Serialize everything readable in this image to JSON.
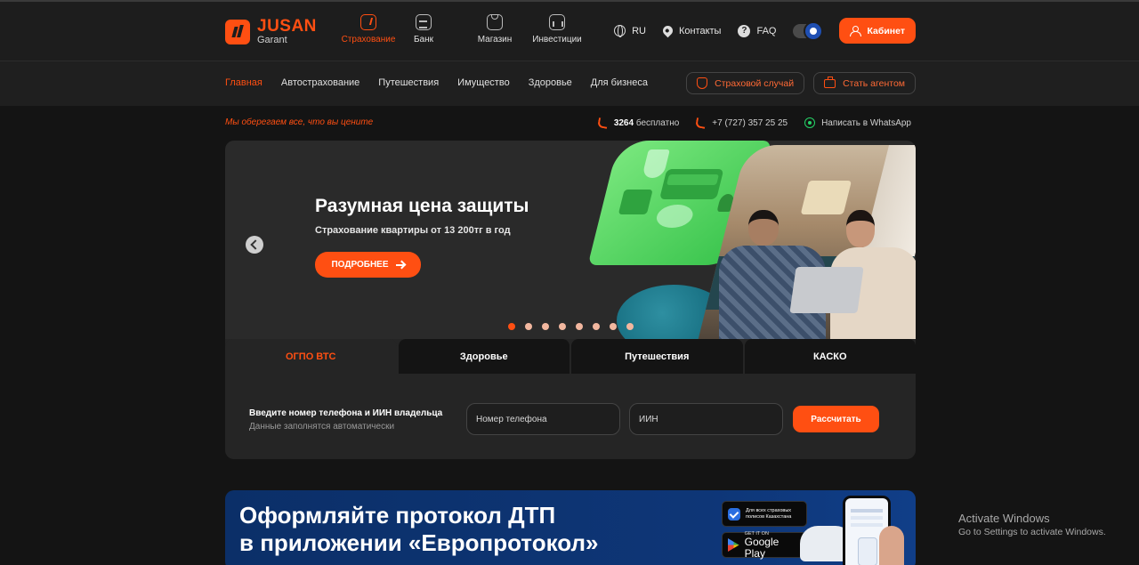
{
  "logo": {
    "brand": "JUSAN",
    "sub": "Garant"
  },
  "main_nav": [
    {
      "label": "Страхование",
      "icon": "shield-icon",
      "active": true
    },
    {
      "label": "Банк",
      "icon": "bank-icon"
    },
    {
      "label": "Магазин",
      "icon": "shopping-bag-icon"
    },
    {
      "label": "Инвестиции",
      "icon": "chart-icon"
    }
  ],
  "header_links": {
    "language": "RU",
    "contacts": "Контакты",
    "faq": "FAQ"
  },
  "theme_toggle": {
    "mode": "dark"
  },
  "cabinet_button": "Кабинет",
  "sub_nav": [
    "Главная",
    "Автострахование",
    "Путешествия",
    "Имущество",
    "Здоровье",
    "Для бизнеса"
  ],
  "sub_nav_buttons": {
    "insured_event": "Страховой случай",
    "become_agent": "Стать агентом"
  },
  "slogan": "Мы оберегаем все, что вы цените",
  "contacts": {
    "short_number": "3264",
    "short_number_suffix": "бесплатно",
    "phone": "+7 (727) 357 25 25",
    "whatsapp": "Написать в WhatsApp"
  },
  "hero": {
    "title": "Разумная цена защиты",
    "subtitle": "Страхование квартиры от 13 200тг в год",
    "cta": "ПОДРОБНЕЕ",
    "slides_total": 8,
    "active_slide": 1
  },
  "calculator": {
    "tabs": [
      "ОГПО ВТС",
      "Здоровье",
      "Путешествия",
      "КАСКО"
    ],
    "active_tab": 0,
    "label": "Введите номер телефона и ИИН владельца",
    "hint": "Данные заполнятся автоматически",
    "phone_placeholder": "Номер телефона",
    "iin_placeholder": "ИИН",
    "button": "Рассчитать"
  },
  "banner": {
    "line1": "Оформляйте протокол ДТП",
    "line2": "в приложении «Европротокол»",
    "store1_line1": "Для всех страховых",
    "store1_line2": "полисов Казахстана",
    "store2_top": "GET IT ON",
    "store2_name": "Google Play"
  },
  "windows_notice": {
    "title": "Activate Windows",
    "text": "Go to Settings to activate Windows."
  },
  "colors": {
    "accent": "#ff4f12",
    "background": "#141414",
    "banner": "#0e3677"
  }
}
